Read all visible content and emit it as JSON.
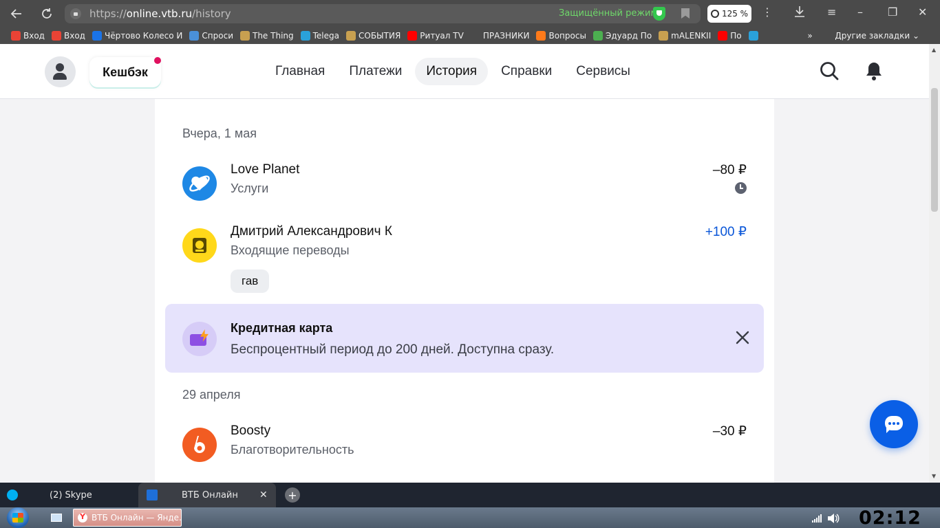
{
  "browser": {
    "url_prefix": "https://",
    "url_host": "online.vtb.ru",
    "url_path": "/history",
    "secure_mode_label": "Защищённый режим",
    "zoom_level": "125 %",
    "bookmarks": [
      {
        "label": "Вход",
        "icon": "google-icon",
        "color": "#ea4335"
      },
      {
        "label": "Вход",
        "icon": "gmail-icon",
        "color": "#ea4335"
      },
      {
        "label": "Чёртово Колесо И",
        "icon": "pause-icon",
        "color": "#1a73e8"
      },
      {
        "label": "Спроси",
        "icon": "spirals-icon",
        "color": "#4a90d9"
      },
      {
        "label": "The Thing",
        "icon": "eagle-icon",
        "color": "#c8a050"
      },
      {
        "label": "Telega",
        "icon": "telegram-icon",
        "color": "#2aa1da"
      },
      {
        "label": "СОБЫТИЯ",
        "icon": "eagle-icon",
        "color": "#c8a050"
      },
      {
        "label": "Ритуал TV",
        "icon": "youtube-icon",
        "color": "#ff0000"
      },
      {
        "label": "ПРАЗНИКИ",
        "icon": "question-icon",
        "color": "#4a4a4a"
      },
      {
        "label": "Вопросы",
        "icon": "fox-icon",
        "color": "#ff7a1a"
      },
      {
        "label": "Эдуард По",
        "icon": "square-green-icon",
        "color": "#4caf50"
      },
      {
        "label": "mALENKII",
        "icon": "eagle-icon",
        "color": "#c8a050"
      },
      {
        "label": "По",
        "icon": "youtube-icon",
        "color": "#ff0000"
      },
      {
        "label": "",
        "icon": "diamond-icon",
        "color": "#2aa1da"
      }
    ],
    "bookmarks_more": "»",
    "other_bookmarks": "Другие закладки"
  },
  "header": {
    "cashback_label": "Кешбэк",
    "tabs": [
      {
        "label": "Главная",
        "active": false
      },
      {
        "label": "Платежи",
        "active": false
      },
      {
        "label": "История",
        "active": true
      },
      {
        "label": "Справки",
        "active": false
      },
      {
        "label": "Сервисы",
        "active": false
      }
    ]
  },
  "history": {
    "groups": [
      {
        "date": "Вчера, 1 мая",
        "items": [
          {
            "name": "Love Planet",
            "category": "Услуги",
            "amount": "–80 ₽",
            "pending": true,
            "logo_color": "#1e88e5"
          },
          {
            "name": "Дмитрий Александрович К",
            "category": "Входящие переводы",
            "amount": "+100 ₽",
            "positive": true,
            "tag": "гав",
            "logo_color": "#ffd81a"
          }
        ]
      },
      {
        "date": "29 апреля",
        "items": [
          {
            "name": "Boosty",
            "category": "Благотворительность",
            "amount": "–30 ₽",
            "logo_color": "#f25c22"
          }
        ]
      }
    ]
  },
  "promo": {
    "title": "Кредитная карта",
    "text": "Беспроцентный период до 200 дней. Доступна сразу."
  },
  "window_tabs": [
    {
      "label": "(2) Skype",
      "active": false
    },
    {
      "label": "ВТБ Онлайн",
      "active": true
    }
  ],
  "taskbar": {
    "task_item": "ВТБ Онлайн — Янде...",
    "time": "02:12"
  },
  "colors": {
    "accent": "#0a5fe6",
    "positive_amount": "#0a56d8",
    "promo_bg": "#e6e3fc",
    "notification_dot": "#e0115f"
  }
}
